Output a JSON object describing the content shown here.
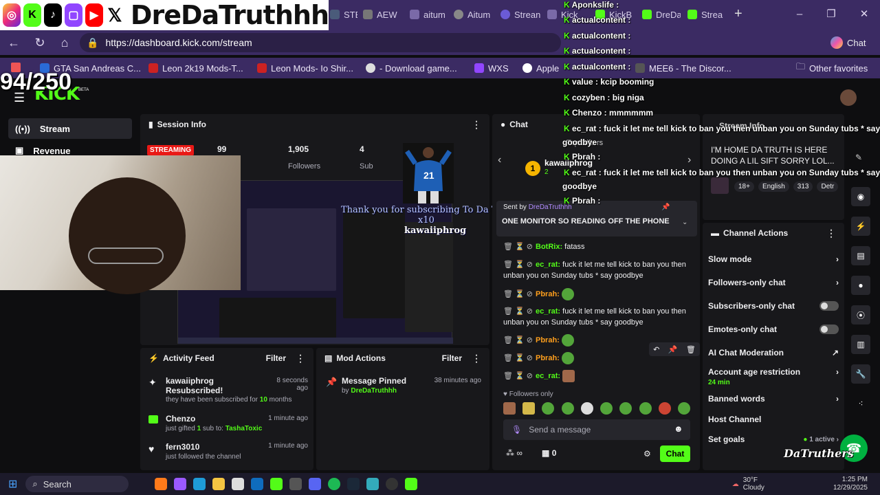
{
  "browser": {
    "tabs": [
      {
        "label": "STEAM"
      },
      {
        "label": "AEW"
      },
      {
        "label": "aitum"
      },
      {
        "label": "Aitum"
      },
      {
        "label": "Strean"
      },
      {
        "label": "Kick"
      },
      {
        "label": "KickB"
      },
      {
        "label": "DreDa"
      },
      {
        "label": "Strea"
      }
    ],
    "url": "https://dashboard.kick.com/stream",
    "bookmarks": [
      {
        "label": "GTA San Andreas C..."
      },
      {
        "label": "Leon 2k19 Mods-T..."
      },
      {
        "label": "Leon Mods- Io Shir..."
      },
      {
        "label": "- Download game..."
      },
      {
        "label": "WXS"
      },
      {
        "label": "Apple"
      },
      {
        "label": "MEE6 - The Discor..."
      },
      {
        "label": "Other favorites"
      }
    ],
    "copilot_label": "Chat"
  },
  "overlay": {
    "handle": "DreDaTruthhh",
    "counter": "94/250",
    "sub_alert": "Thank you for subscribing To Da Truthers",
    "sub_multiplier": "x10",
    "sub_name": "kawaiiphrog"
  },
  "brand": {
    "logo": "KICK",
    "beta": "BETA"
  },
  "sidebar": {
    "items": [
      {
        "label": "Stream"
      },
      {
        "label": "Revenue"
      }
    ]
  },
  "session": {
    "title": "Session Info",
    "badge": "STREAMING",
    "stats": [
      {
        "value": "99"
      },
      {
        "value": "1,905"
      },
      {
        "value": "4"
      }
    ],
    "stat_labels": [
      "Followers",
      "Sub"
    ]
  },
  "activity": {
    "title": "Activity Feed",
    "filter": "Filter",
    "items": [
      {
        "name": "kawaiiphrog",
        "line2": "Resubscribed!",
        "detail_pre": "they have been subscribed for ",
        "detail_num": "10",
        "detail_post": " months",
        "time": "8 seconds ago"
      },
      {
        "name": "Chenzo",
        "detail_pre": "just gifted ",
        "detail_num": "1",
        "detail_post": " sub to: ",
        "target": "TashaToxic",
        "time": "1 minute ago"
      },
      {
        "name": "fern3010",
        "detail_pre": "just followed the channel",
        "time": "1 minute ago"
      }
    ]
  },
  "mod": {
    "title": "Mod Actions",
    "filter": "Filter",
    "item": {
      "title": "Message Pinned",
      "by": "by ",
      "user": "DreDaTruthhh",
      "time": "38 minutes ago"
    }
  },
  "chat": {
    "title": "Chat",
    "gift_user": "kawaiiphrog",
    "gift_count": "2",
    "top_gifters": "Top Gifters",
    "pinned_by_label": "Sent by",
    "pinned_by": "DreDaTruthhh",
    "pinned_text": "ONE MONITOR SO READING OFF THE PHONE",
    "messages": [
      {
        "user": "BotRix:",
        "text": "fatass"
      },
      {
        "user": "ec_rat:",
        "text": "fuck it let me tell kick to ban you then unban you on Sunday tubs * say goodbye"
      },
      {
        "user": "Pbrah:",
        "text": ""
      },
      {
        "user": "ec_rat:",
        "text": "fuck it let me tell kick to ban you then unban you on Sunday tubs * say goodbye"
      },
      {
        "user": "Pbrah:",
        "text": ""
      },
      {
        "user": "Pbrah:",
        "text": ""
      },
      {
        "user": "ec_rat:",
        "text": ""
      }
    ],
    "followers_only": "Followers only",
    "placeholder": "Send a message",
    "count": "0",
    "send": "Chat"
  },
  "stream_info": {
    "title": "Stream Info",
    "text": "I'M HOME DA TRUTH IS HERE DOING A LIL SIFT SORRY LOL...",
    "tags": [
      "18+",
      "English",
      "313",
      "Detr"
    ]
  },
  "actions": {
    "title": "Channel Actions",
    "items": [
      {
        "label": "Slow mode"
      },
      {
        "label": "Followers-only chat"
      },
      {
        "label": "Subscribers-only chat"
      },
      {
        "label": "Emotes-only chat"
      },
      {
        "label": "AI Chat Moderation"
      },
      {
        "label": "Account age restriction",
        "sub": "24 min"
      },
      {
        "label": "Banned words"
      },
      {
        "label": "Host Channel"
      },
      {
        "label": "Set goals",
        "sub": "1 active"
      }
    ]
  },
  "overlay_chat": [
    {
      "user": "Aponkslife :",
      "text": ""
    },
    {
      "user": "actualcontent :",
      "text": ""
    },
    {
      "user": "actualcontent :",
      "text": ""
    },
    {
      "user": "actualcontent :",
      "text": ""
    },
    {
      "user": "actualcontent :",
      "text": ""
    },
    {
      "user": "value :",
      "text": "kcip booming"
    },
    {
      "user": "cozyben :",
      "text": "big niga"
    },
    {
      "user": "Chenzo :",
      "text": "mmmmmm"
    },
    {
      "user": "ec_rat :",
      "text": "fuck it let me tell kick to ban you then unban you on Sunday tubs * say"
    },
    {
      "user": "",
      "text": "goodbye"
    },
    {
      "user": "Pbrah :",
      "text": ""
    },
    {
      "user": "ec_rat :",
      "text": "fuck it let me tell kick to ban you then unban you on Sunday tubs * say"
    },
    {
      "user": "",
      "text": "goodbye"
    },
    {
      "user": "Pbrah :",
      "text": ""
    }
  ],
  "taskbar": {
    "search": "Search",
    "weather_temp": "30°F",
    "weather_desc": "Cloudy",
    "time": "1:25 PM",
    "date": "12/29/2025",
    "corner_logo": "DaTruthers"
  }
}
